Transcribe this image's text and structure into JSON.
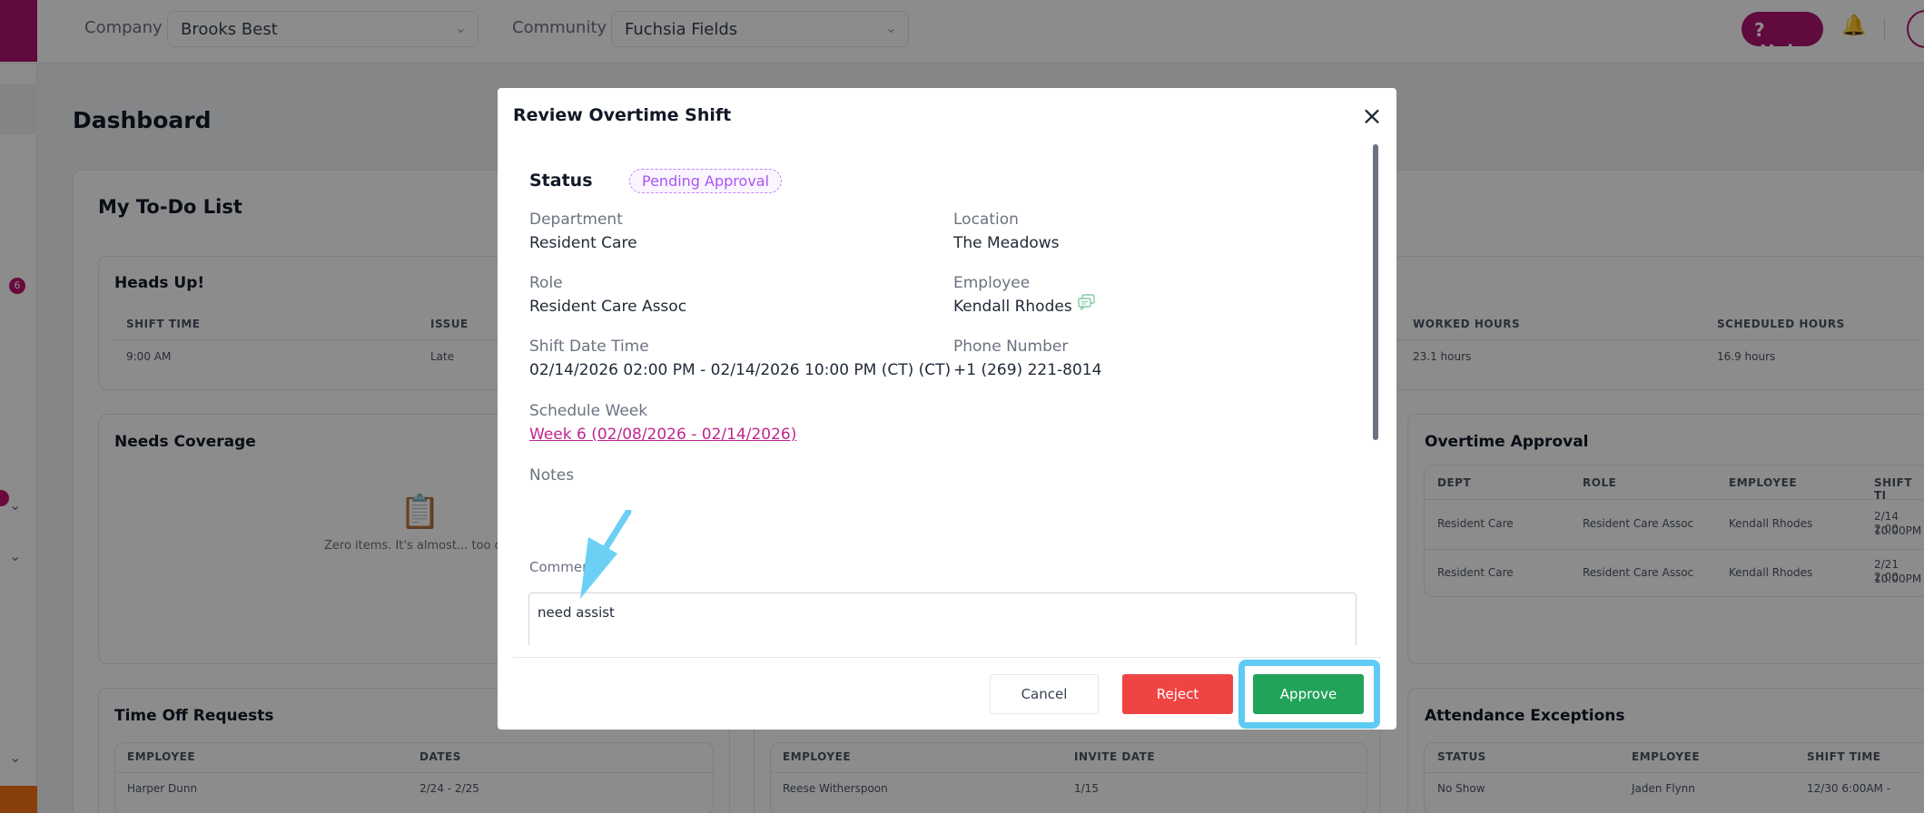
{
  "topbar": {
    "company_label": "Company",
    "company_value": "Brooks Best",
    "community_label": "Community",
    "community_value": "Fuchsia Fields",
    "help_label": "Help",
    "help_icon": "?"
  },
  "sidebar": {
    "badge_count": "6"
  },
  "page": {
    "title": "Dashboard",
    "todo_title": "My To-Do List"
  },
  "heads_up": {
    "title": "Heads Up!",
    "headers": [
      "SHIFT TIME",
      "ISSUE",
      "WORKED HOURS",
      "SCHEDULED HOURS"
    ],
    "row": [
      "9:00 AM",
      "Late",
      "23.1 hours",
      "16.9 hours"
    ]
  },
  "needs_coverage": {
    "title": "Needs Coverage",
    "empty_text": "Zero items. It's almost... too quiet."
  },
  "overtime_approval": {
    "title": "Overtime Approval",
    "headers": [
      "DEPT",
      "ROLE",
      "EMPLOYEE",
      "SHIFT TI"
    ],
    "rows": [
      [
        "Resident Care",
        "Resident Care Assoc",
        "Kendall Rhodes",
        "2/14 2:00",
        "10:00PM"
      ],
      [
        "Resident Care",
        "Resident Care Assoc",
        "Kendall Rhodes",
        "2/21 2:00",
        "10:00PM"
      ]
    ]
  },
  "time_off": {
    "title": "Time Off Requests",
    "headers": [
      "EMPLOYEE",
      "DATES"
    ],
    "row": [
      "Harper Dunn",
      "2/24 - 2/25"
    ]
  },
  "invites": {
    "headers": [
      "EMPLOYEE",
      "INVITE DATE"
    ],
    "row": [
      "Reese Witherspoon",
      "1/15"
    ]
  },
  "attendance": {
    "title": "Attendance Exceptions",
    "headers": [
      "STATUS",
      "EMPLOYEE",
      "SHIFT TIME"
    ],
    "row": [
      "No Show",
      "Jaden Flynn",
      "12/30 6:00AM -"
    ]
  },
  "modal": {
    "title": "Review Overtime Shift",
    "close_icon": "×",
    "status_label": "Status",
    "status_value": "Pending Approval",
    "department_label": "Department",
    "department_value": "Resident Care",
    "location_label": "Location",
    "location_value": "The Meadows",
    "role_label": "Role",
    "role_value": "Resident Care Assoc",
    "employee_label": "Employee",
    "employee_value": "Kendall Rhodes",
    "shift_label": "Shift Date Time",
    "shift_value": "02/14/2026 02:00 PM - 02/14/2026 10:00 PM (CT) (CT)",
    "phone_label": "Phone Number",
    "phone_value": "+1 (269) 221-8014",
    "week_label": "Schedule Week",
    "week_value": "Week 6 (02/08/2026 - 02/14/2026)",
    "notes_label": "Notes",
    "comment_label": "Comment",
    "comment_value": "need assist",
    "cancel_label": "Cancel",
    "reject_label": "Reject",
    "approve_label": "Approve"
  },
  "colors": {
    "brand": "#b0136f",
    "reject": "#ef4444",
    "approve": "#22a35a",
    "highlight": "#5ecbf5",
    "pending": "#a855f7"
  }
}
